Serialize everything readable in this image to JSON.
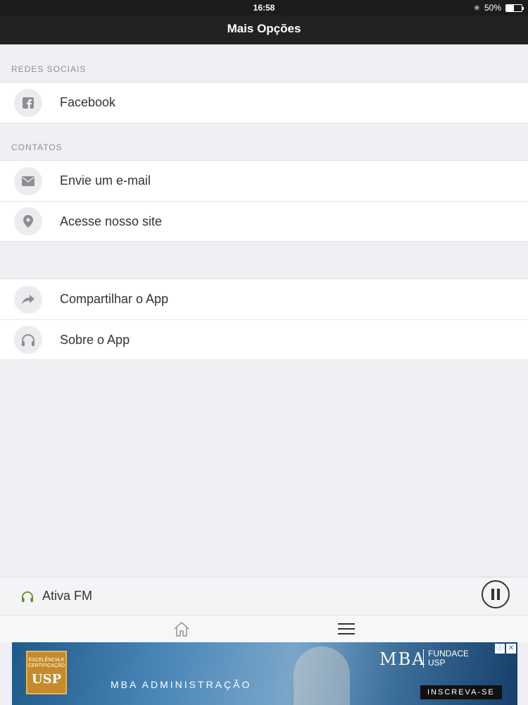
{
  "status": {
    "time": "16:58",
    "battery": "50%",
    "battery_level": 0.5
  },
  "navbar": {
    "title": "Mais Opções"
  },
  "sections": {
    "social": {
      "header": "REDES SOCIAIS",
      "items": [
        {
          "label": "Facebook",
          "icon": "facebook-icon"
        }
      ]
    },
    "contacts": {
      "header": "CONTATOS",
      "items": [
        {
          "label": "Envie um e-mail",
          "icon": "mail-icon"
        },
        {
          "label": "Acesse nosso site",
          "icon": "location-pin-icon"
        }
      ]
    },
    "app": {
      "items": [
        {
          "label": "Compartilhar o App",
          "icon": "share-icon"
        },
        {
          "label": "Sobre o App",
          "icon": "headphones-icon"
        }
      ]
    }
  },
  "player": {
    "station": "Ativa FM",
    "icon": "headphones-icon",
    "accent": "#6a8a2a"
  },
  "tabbar": {
    "tabs": [
      {
        "icon": "home-icon"
      },
      {
        "icon": "menu-icon"
      }
    ]
  },
  "ad": {
    "seal_text": "EXCELÊNCIA E CERTIFICAÇÃO",
    "seal_brand": "USP",
    "headline": "MBA ADMINISTRAÇÃO",
    "brand": "MBA",
    "partner": "FUNDACE",
    "partner_sub": "USP",
    "cta": "INSCREVA-SE",
    "info_glyph": "ⓘ",
    "close_glyph": "✕"
  }
}
